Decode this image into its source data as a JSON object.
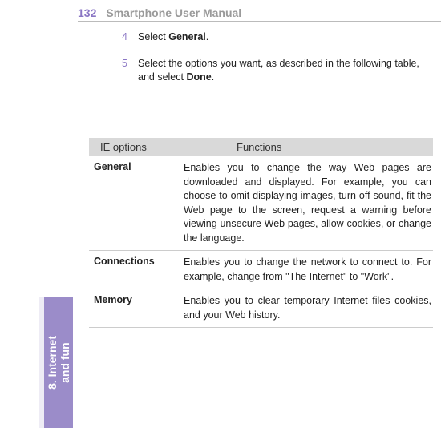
{
  "header": {
    "page_number": "132",
    "manual_title": "Smartphone User Manual"
  },
  "steps": [
    {
      "num": "4",
      "prefix": "Select ",
      "bold": "General",
      "suffix": "."
    },
    {
      "num": "5",
      "prefix": "Select the options you want, as described in the following table, and select ",
      "bold": "Done",
      "suffix": "."
    }
  ],
  "table": {
    "header": {
      "options": "IE options",
      "functions": "Functions"
    },
    "rows": [
      {
        "option": "General",
        "function": "Enables you to change the way Web pages are downloaded and displayed. For example, you can choose to omit displaying images, turn off sound, fit the Web page to the screen, request a warning before viewing unsecure Web pages, allow cookies, or change the language."
      },
      {
        "option": "Connections",
        "function": "Enables you to change the network to connect to.  For example, change from \"The Internet\" to \"Work\"."
      },
      {
        "option": "Memory",
        "function": "Enables you to clear temporary Internet files cookies, and your Web history."
      }
    ]
  },
  "side_tab": {
    "line1": "8. Internet",
    "line2": "and fun"
  }
}
